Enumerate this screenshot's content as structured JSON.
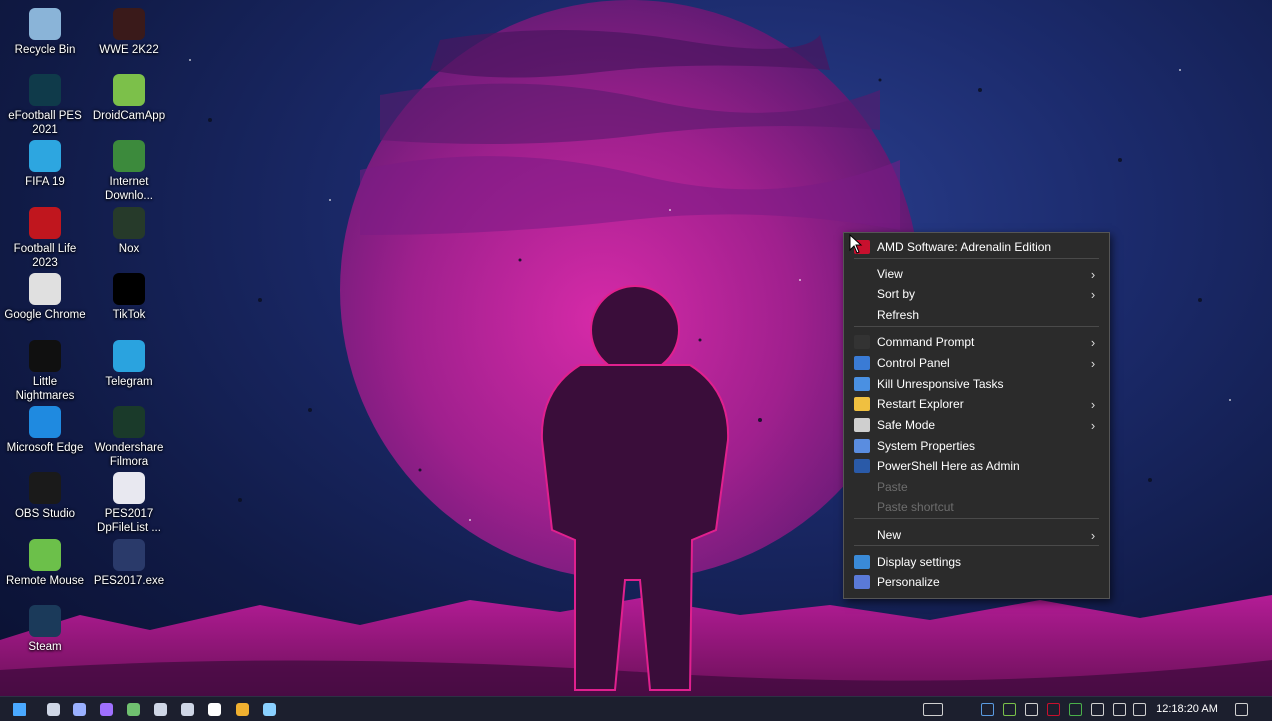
{
  "desktop": {
    "icons": [
      {
        "label": "Recycle Bin",
        "icon": "recycle-bin-icon",
        "color": "#8ab4d8"
      },
      {
        "label": "WWE 2K22",
        "icon": "wwe-icon",
        "color": "#3a1a1a"
      },
      {
        "label": "eFootball PES 2021",
        "icon": "efootball-icon",
        "color": "#0f3a4a"
      },
      {
        "label": "DroidCamApp",
        "icon": "droidcam-icon",
        "color": "#7cc04a"
      },
      {
        "label": "FIFA 19",
        "icon": "fifa-icon",
        "color": "#2da6e0"
      },
      {
        "label": "Internet Downlo...",
        "icon": "idm-icon",
        "color": "#3c8a3c"
      },
      {
        "label": "Football Life 2023",
        "icon": "football-life-icon",
        "color": "#c0161e"
      },
      {
        "label": "Nox",
        "icon": "nox-icon",
        "color": "#263a2a"
      },
      {
        "label": "Google Chrome",
        "icon": "chrome-icon",
        "color": "#e0e0e0"
      },
      {
        "label": "TikTok",
        "icon": "tiktok-icon",
        "color": "#000000"
      },
      {
        "label": "Little Nightmares",
        "icon": "little-nightmares-icon",
        "color": "#101010"
      },
      {
        "label": "Telegram",
        "icon": "telegram-icon",
        "color": "#2aa3df"
      },
      {
        "label": "Microsoft Edge",
        "icon": "edge-icon",
        "color": "#1f8ae0"
      },
      {
        "label": "Wondershare Filmora",
        "icon": "filmora-icon",
        "color": "#1a3a2a"
      },
      {
        "label": "OBS Studio",
        "icon": "obs-icon",
        "color": "#1a1a1a"
      },
      {
        "label": "PES2017 DpFileList ...",
        "icon": "pes2017-file-icon",
        "color": "#e8e8f0"
      },
      {
        "label": "Remote Mouse",
        "icon": "remote-mouse-icon",
        "color": "#6cc04a"
      },
      {
        "label": "PES2017.exe",
        "icon": "pes2017-exe-icon",
        "color": "#2a3a6a"
      },
      {
        "label": "Steam",
        "icon": "steam-icon",
        "color": "#1b3a5a"
      }
    ]
  },
  "context_menu": {
    "items": [
      {
        "label": "AMD Software: Adrenalin Edition",
        "icon": "amd-icon",
        "submenu": false,
        "disabled": false
      },
      {
        "label": "View",
        "icon": "",
        "submenu": true,
        "disabled": false
      },
      {
        "label": "Sort by",
        "icon": "",
        "submenu": true,
        "disabled": false
      },
      {
        "label": "Refresh",
        "icon": "",
        "submenu": false,
        "disabled": false
      },
      {
        "label": "Command Prompt",
        "icon": "cmd-icon",
        "submenu": true,
        "disabled": false
      },
      {
        "label": "Control Panel",
        "icon": "control-panel-icon",
        "submenu": true,
        "disabled": false
      },
      {
        "label": "Kill Unresponsive Tasks",
        "icon": "kill-tasks-icon",
        "submenu": false,
        "disabled": false
      },
      {
        "label": "Restart Explorer",
        "icon": "explorer-icon",
        "submenu": true,
        "disabled": false
      },
      {
        "label": "Safe Mode",
        "icon": "gear-icon",
        "submenu": true,
        "disabled": false
      },
      {
        "label": "System Properties",
        "icon": "system-properties-icon",
        "submenu": false,
        "disabled": false
      },
      {
        "label": "PowerShell Here as Admin",
        "icon": "powershell-icon",
        "submenu": false,
        "disabled": false
      },
      {
        "label": "Paste",
        "icon": "",
        "submenu": false,
        "disabled": true
      },
      {
        "label": "Paste shortcut",
        "icon": "",
        "submenu": false,
        "disabled": true
      },
      {
        "label": "New",
        "icon": "",
        "submenu": true,
        "disabled": false
      },
      {
        "label": "Display settings",
        "icon": "display-icon",
        "submenu": false,
        "disabled": false
      },
      {
        "label": "Personalize",
        "icon": "personalize-icon",
        "submenu": false,
        "disabled": false
      }
    ]
  },
  "taskbar": {
    "clock": "12:18:20 AM",
    "pinned": [
      "start-icon",
      "task-view-icon",
      "app-icon",
      "app-icon",
      "file-manager-icon",
      "steam-icon",
      "capture-icon",
      "m-icon",
      "folder-icon",
      "chat-icon",
      "obs-icon"
    ],
    "tray": [
      "keyboard-icon",
      "tray-app-icon",
      "tray-app-icon",
      "tray-app-icon",
      "tray-app-icon",
      "tray-app-icon",
      "microphone-icon",
      "network-icon",
      "volume-icon",
      "notification-icon"
    ]
  }
}
